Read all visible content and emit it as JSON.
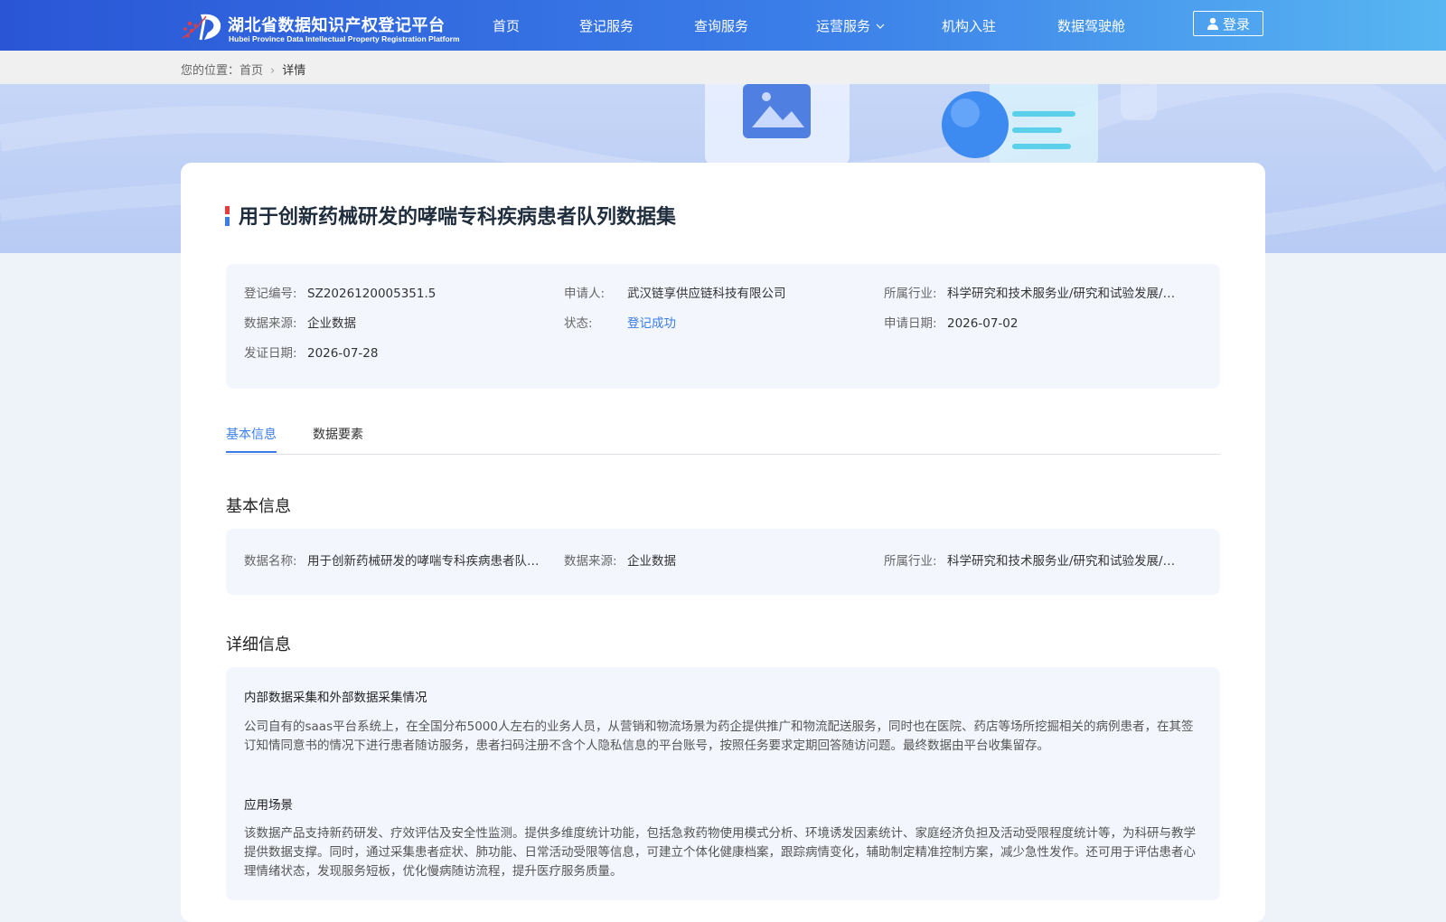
{
  "header": {
    "logo_cn": "湖北省数据知识产权登记平台",
    "logo_en": "Hubei Province Data Intellectual Property Registration Platform",
    "nav": [
      "首页",
      "登记服务",
      "查询服务",
      "运营服务",
      "机构入驻",
      "数据驾驶舱"
    ],
    "login_label": "登录"
  },
  "breadcrumb": {
    "prefix": "您的位置：",
    "home": "首页",
    "current": "详情"
  },
  "detail": {
    "title": "用于创新药械研发的哮喘专科疾病患者队列数据集",
    "summary": {
      "reg_no_label": "登记编号:",
      "reg_no": "SZ2026120005351.5",
      "applicant_label": "申请人:",
      "applicant": "武汉链享供应链科技有限公司",
      "industry_label": "所属行业:",
      "industry": "科学研究和技术服务业/研究和试验发展/医学研究和试验发展",
      "source_label": "数据来源:",
      "source": "企业数据",
      "status_label": "状态:",
      "status": "登记成功",
      "apply_date_label": "申请日期:",
      "apply_date": "2026-07-02",
      "issue_date_label": "发证日期:",
      "issue_date": "2026-07-28"
    },
    "tabs": [
      "基本信息",
      "数据要素"
    ],
    "basic": {
      "heading": "基本信息",
      "name_label": "数据名称:",
      "name": "用于创新药械研发的哮喘专科疾病患者队列数据集",
      "source_label": "数据来源:",
      "source": "企业数据",
      "industry_label": "所属行业:",
      "industry": "科学研究和技术服务业/研究和试验发展/医学研究和试验发展"
    },
    "more": {
      "heading": "详细信息",
      "collect_title": "内部数据采集和外部数据采集情况",
      "collect_text": "公司自有的saas平台系统上，在全国分布5000人左右的业务人员，从营销和物流场景为药企提供推广和物流配送服务，同时也在医院、药店等场所挖掘相关的病例患者，在其签订知情同意书的情况下进行患者随访服务，患者扫码注册不含个人隐私信息的平台账号，按照任务要求定期回答随访问题。最终数据由平台收集留存。",
      "scene_title": "应用场景",
      "scene_text": "该数据产品支持新药研发、疗效评估及安全性监测。提供多维度统计功能，包括急救药物使用模式分析、环境诱发因素统计、家庭经济负担及活动受限程度统计等，为科研与教学提供数据支撑。同时，通过采集患者症状、肺功能、日常活动受限等信息，可建立个体化健康档案，跟踪病情变化，辅助制定精准控制方案，减少急性发作。还可用于评估患者心理情绪状态，发现服务短板，优化慢病随访流程，提升医疗服务质量。"
    }
  },
  "colors": {
    "primary": "#3a7de8",
    "header_start": "#2a56d6",
    "header_end": "#58b6f2",
    "box_bg": "#f3f6fd"
  }
}
